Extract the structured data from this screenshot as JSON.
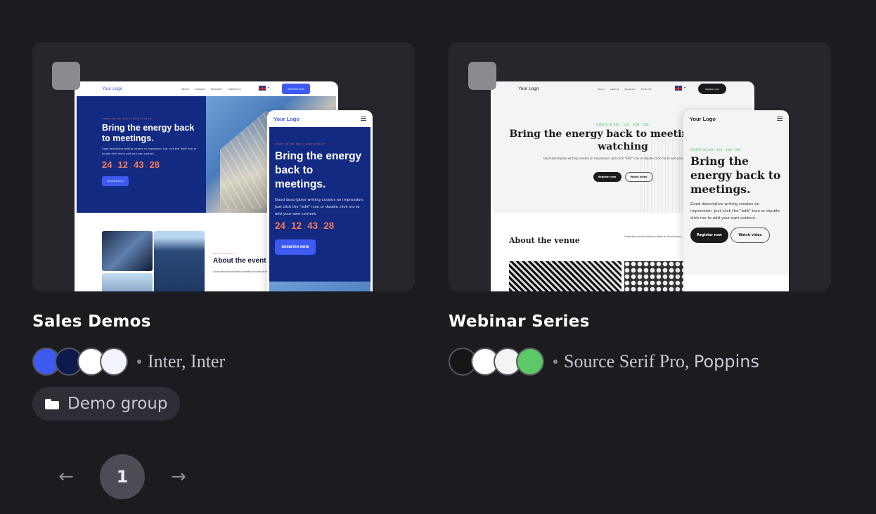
{
  "templates": [
    {
      "title": "Sales Demos",
      "colors": [
        "#3d5af1",
        "#0e1a4d",
        "#ffffff",
        "#f1f4fd"
      ],
      "fonts": {
        "heading": "Inter",
        "body": "Inter"
      },
      "group": "Demo group",
      "preview": {
        "logo": "Your Logo",
        "nav": [
          "ABOUT",
          "AGENDA",
          "SPEAKERS",
          "PRODUCTS"
        ],
        "cta": "REGISTER NOW",
        "eyebrow": "STARTS ON TUE, MAY 21 2020 10:00 AM",
        "headline": "Bring the energy back to meetings.",
        "paragraph": "Good descriptive writing creates an impression. Just click the \"edit\" icon or double click me to add your own content.",
        "countdown": [
          "24",
          "12",
          "43",
          "28"
        ],
        "countdown_labels": [
          "DAYS",
          "HOURS",
          "MINUTES",
          "SECONDS"
        ],
        "button": "REGISTER NOW",
        "about_label": "ABOUT THE EVENT",
        "about_title": "About the event",
        "about_paragraph": "Good descriptive writing creates a mind of an event, a place, a person, mood. Just click \"edit\" icon or double own content."
      }
    },
    {
      "title": "Webinar Series",
      "colors": [
        "#161616",
        "#ffffff",
        "#f3f4f6",
        "#5cc86a"
      ],
      "fonts": {
        "heading": "Source Serif Pro",
        "body": "Poppins"
      },
      "group": null,
      "preview": {
        "logo": "Your Logo",
        "nav": [
          "About",
          "Agenda",
          "Speakers",
          "Products"
        ],
        "cta": "Register now",
        "eyebrow": "STARTS IN 24D : 12H : 43M : 28S",
        "headline": "Bring the energy back to meetings worth watching",
        "mobile_headline": "Bring the energy back to meetings.",
        "paragraph": "Good descriptive writing creates an impression. Just click \"Edit\" icon or double click me to add your own content.",
        "mobile_paragraph": "Good descriptive writing creates an impression. Just click the \"edit\" icon or double click me to add your own content.",
        "button_primary": "Register now",
        "button_secondary": "Watch video",
        "about_title": "About the venue",
        "about_paragraph": "Good descriptive writing creates an of an event, a place, a person, or a th click \"Edit\" icon or double click me to"
      }
    }
  ],
  "pagination": {
    "prev_icon": "arrow-left-icon",
    "current": "1",
    "next_icon": "arrow-right-icon",
    "prev_glyph": "←",
    "next_glyph": "→"
  }
}
